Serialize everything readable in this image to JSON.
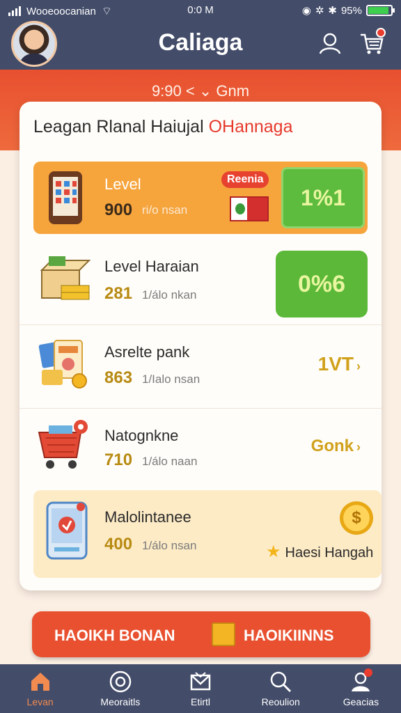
{
  "status_bar": {
    "carrier": "Wooeoocanian",
    "time": "0:0 M",
    "battery": "95%"
  },
  "header": {
    "title": "Caliaga"
  },
  "band": {
    "subline": "9:90 < ⌄ Gnm"
  },
  "card": {
    "title_part1": "Leagan Rlanal Haiujal ",
    "title_part2": "OHannaga",
    "rows": [
      {
        "title": "Level",
        "value": "900",
        "sub": "ri/o nsan",
        "badge": "Reenia",
        "box_value": "1%1"
      },
      {
        "title": "Level Haraian",
        "value": "281",
        "sub": "1/álo nkan",
        "box_value": "0%6"
      },
      {
        "title": "Asrelte pank",
        "value": "863",
        "sub": "1/Ialo nsan",
        "side": "1VT"
      },
      {
        "title": "Natognkne",
        "value": "710",
        "sub": "1/álo naan",
        "side": "Gonk"
      },
      {
        "title": "Malolintanee",
        "value": "400",
        "sub": "1/álo nsan",
        "star_label": "Haesi Hangah",
        "coin_symbol": "$"
      }
    ]
  },
  "cta": {
    "left_label": "HAOIKH BONAN",
    "right_label": "HAOIKIINNS"
  },
  "nav": [
    {
      "label": "Levan",
      "icon": "home-icon",
      "active": true
    },
    {
      "label": "Meoraitls",
      "icon": "compass-icon",
      "active": false
    },
    {
      "label": "Etirtl",
      "icon": "mail-icon",
      "active": false
    },
    {
      "label": "Reoulion",
      "icon": "search-icon",
      "active": false
    },
    {
      "label": "Geacias",
      "icon": "profile-icon",
      "active": false
    }
  ],
  "colors": {
    "nav_bg": "#434c69",
    "accent": "#e8502f",
    "gold": "#d1a11c",
    "green": "#5bb838"
  }
}
